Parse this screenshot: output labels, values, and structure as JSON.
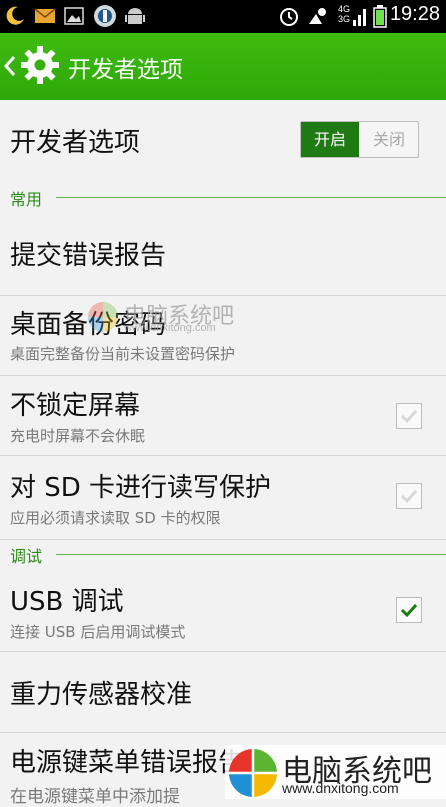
{
  "status_bar": {
    "time": "19:28",
    "network_top": "4G",
    "network_bottom": "3G",
    "icons": [
      "moon-icon",
      "mail-icon",
      "image-icon",
      "vpn-icon",
      "android-icon",
      "alarm-icon",
      "weather-icon",
      "signal-icon",
      "battery-icon"
    ]
  },
  "title_bar": {
    "title": "开发者选项",
    "back_icon": "chevron-left-icon",
    "app_icon": "gear-icon"
  },
  "developer_toggle": {
    "label": "开发者选项",
    "on_label": "开启",
    "off_label": "关闭",
    "state": "on"
  },
  "sections": {
    "common": "常用",
    "debug": "调试"
  },
  "items": [
    {
      "title": "提交错误报告"
    },
    {
      "title": "桌面备份密码",
      "subtitle": "桌面完整备份当前未设置密码保护"
    },
    {
      "title": "不锁定屏幕",
      "subtitle": "充电时屏幕不会休眠",
      "checked": false
    },
    {
      "title": "对 SD 卡进行读写保护",
      "subtitle": "应用必须请求读取 SD 卡的权限",
      "checked": false
    },
    {
      "title": "USB 调试",
      "subtitle": "连接 USB 后启用调试模式",
      "checked": true
    },
    {
      "title": "重力传感器校准"
    },
    {
      "title": "电源键菜单错误报告",
      "subtitle": "在电源键菜单中添加提"
    }
  ],
  "watermark": {
    "center_text": "电脑系统吧",
    "center_url": "www.dnxitong.com",
    "corner_text": "电脑系统吧",
    "corner_url": "www.dnxitong.com"
  },
  "colors": {
    "accent": "#2ea808",
    "toggle_on": "#1f7a14",
    "section_text": "#2e8b1a"
  }
}
